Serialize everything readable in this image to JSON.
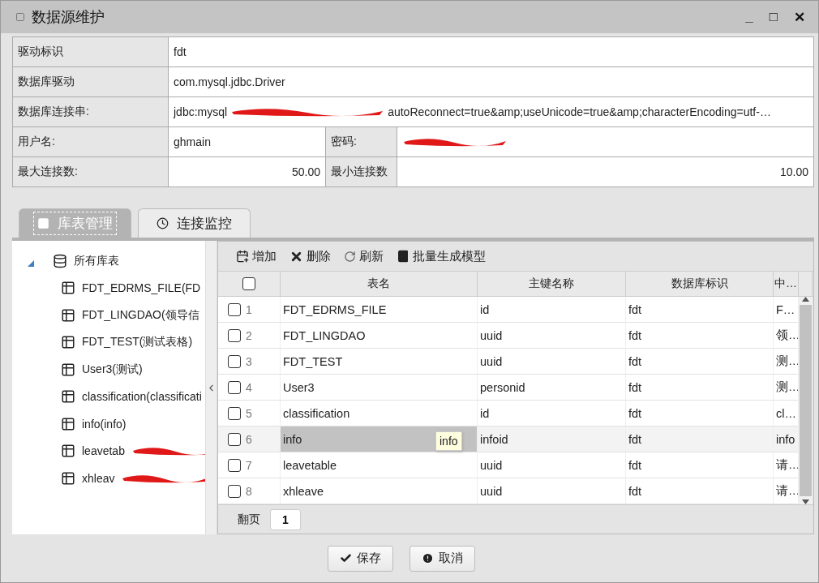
{
  "window": {
    "title": "数据源维护",
    "controls": [
      "_",
      "□",
      "✕"
    ]
  },
  "form": [
    {
      "kind": "single",
      "label": "驱动标识",
      "value": "fdt"
    },
    {
      "kind": "single",
      "label": "数据库驱动",
      "value": "com.mysql.jdbc.Driver"
    },
    {
      "kind": "redacted",
      "label": "数据库连接串:",
      "prefix": "jdbc:mysql",
      "suffix": "autoReconnect=true&amp;useUnicode=true&amp;characterEncoding=utf-…"
    },
    {
      "kind": "pair_redacted",
      "label": "用户名:",
      "value": "ghmain",
      "label2": "密码:"
    },
    {
      "kind": "pair_numeric",
      "label": "最大连接数:",
      "value": "50.00",
      "label2": "最小连接数",
      "value2": "10.00"
    }
  ],
  "tabs": [
    {
      "label": "库表管理",
      "selected": true
    },
    {
      "label": "连接监控",
      "selected": false
    }
  ],
  "tree": {
    "label": "所有库表",
    "expanded": true,
    "children": [
      {
        "kind": "plain",
        "label": "FDT_EDRMS_FILE(FD"
      },
      {
        "kind": "plain",
        "label": "FDT_LINGDAO(领导信"
      },
      {
        "kind": "plain",
        "label": "FDT_TEST(测试表格)"
      },
      {
        "kind": "plain",
        "label": "User3(测试)"
      },
      {
        "kind": "plain",
        "label": "classification(classificati"
      },
      {
        "kind": "plain",
        "label": "info(info)"
      },
      {
        "kind": "redacted",
        "label": "leavetab"
      },
      {
        "kind": "redacted",
        "label": "xhleav"
      }
    ]
  },
  "toolbar": [
    "增加",
    "删除",
    "刷新",
    "批量生成模型"
  ],
  "table": {
    "header_checked": false,
    "columns": [
      "表名",
      "主键名称",
      "数据库标识",
      "中…"
    ],
    "rows": [
      {
        "num": "1",
        "cells": [
          "FDT_EDRMS_FILE",
          "id",
          "fdt",
          "F…"
        ],
        "checked": false,
        "selected": false
      },
      {
        "num": "2",
        "cells": [
          "FDT_LINGDAO",
          "uuid",
          "fdt",
          "领…"
        ],
        "checked": false,
        "selected": false
      },
      {
        "num": "3",
        "cells": [
          "FDT_TEST",
          "uuid",
          "fdt",
          "测…"
        ],
        "checked": false,
        "selected": false
      },
      {
        "num": "4",
        "cells": [
          "User3",
          "personid",
          "fdt",
          "测…"
        ],
        "checked": false,
        "selected": false
      },
      {
        "num": "5",
        "cells": [
          "classification",
          "id",
          "fdt",
          "cl…"
        ],
        "checked": false,
        "selected": false
      },
      {
        "num": "6",
        "cells": [
          "info",
          "infoid",
          "fdt",
          "info"
        ],
        "checked": false,
        "selected": true
      },
      {
        "num": "7",
        "cells": [
          "leavetable",
          "uuid",
          "fdt",
          "请…"
        ],
        "checked": false,
        "selected": false
      },
      {
        "num": "8",
        "cells": [
          "xhleave",
          "uuid",
          "fdt",
          "请…"
        ],
        "checked": false,
        "selected": false
      }
    ],
    "tooltip": "info"
  },
  "pager": {
    "label": "翻页",
    "value": "1"
  },
  "buttons": [
    "保存",
    "取消"
  ]
}
